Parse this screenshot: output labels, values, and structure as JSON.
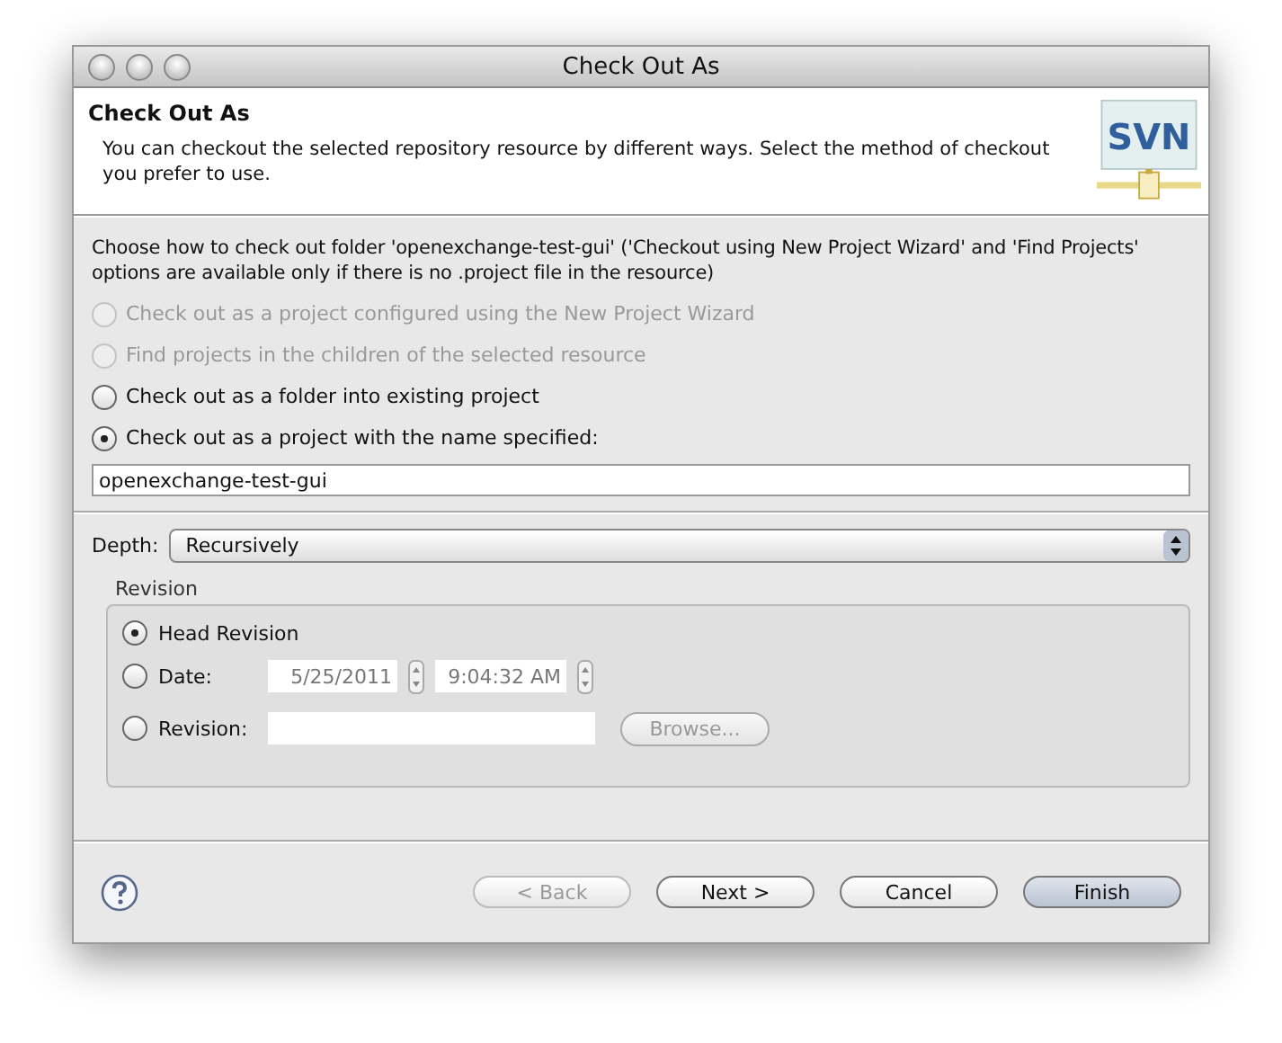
{
  "window": {
    "title": "Check Out As"
  },
  "header": {
    "title": "Check Out As",
    "logo": "SVN",
    "description": "You can checkout the selected repository resource by different ways. Select the method of checkout you prefer to use."
  },
  "intro": "Choose how to check out folder 'openexchange-test-gui' ('Checkout using New Project Wizard' and 'Find Projects' options are available only if there is no .project file in the resource)",
  "options": [
    {
      "label": "Check out as a project configured using the New Project Wizard",
      "selected": false,
      "disabled": true
    },
    {
      "label": "Find projects in the children of the selected resource",
      "selected": false,
      "disabled": true
    },
    {
      "label": "Check out as a folder into existing project",
      "selected": false,
      "disabled": false
    },
    {
      "label": "Check out as a project with the name specified:",
      "selected": true,
      "disabled": false
    }
  ],
  "project_name": {
    "value": "openexchange-test-gui"
  },
  "depth": {
    "label": "Depth:",
    "value": "Recursively"
  },
  "revision": {
    "title": "Revision",
    "options": [
      {
        "kind": "head",
        "label": "Head Revision",
        "selected": true
      },
      {
        "kind": "date",
        "label": "Date:",
        "selected": false,
        "date": "5/25/2011",
        "time": "9:04:32 AM"
      },
      {
        "kind": "number",
        "label": "Revision:",
        "selected": false,
        "button": "Browse..."
      }
    ]
  },
  "buttons": [
    {
      "label": "< Back",
      "disabled": true,
      "default": false
    },
    {
      "label": "Next >",
      "disabled": false,
      "default": false
    },
    {
      "label": "Cancel",
      "disabled": false,
      "default": false
    },
    {
      "label": "Finish",
      "disabled": false,
      "default": true
    }
  ]
}
